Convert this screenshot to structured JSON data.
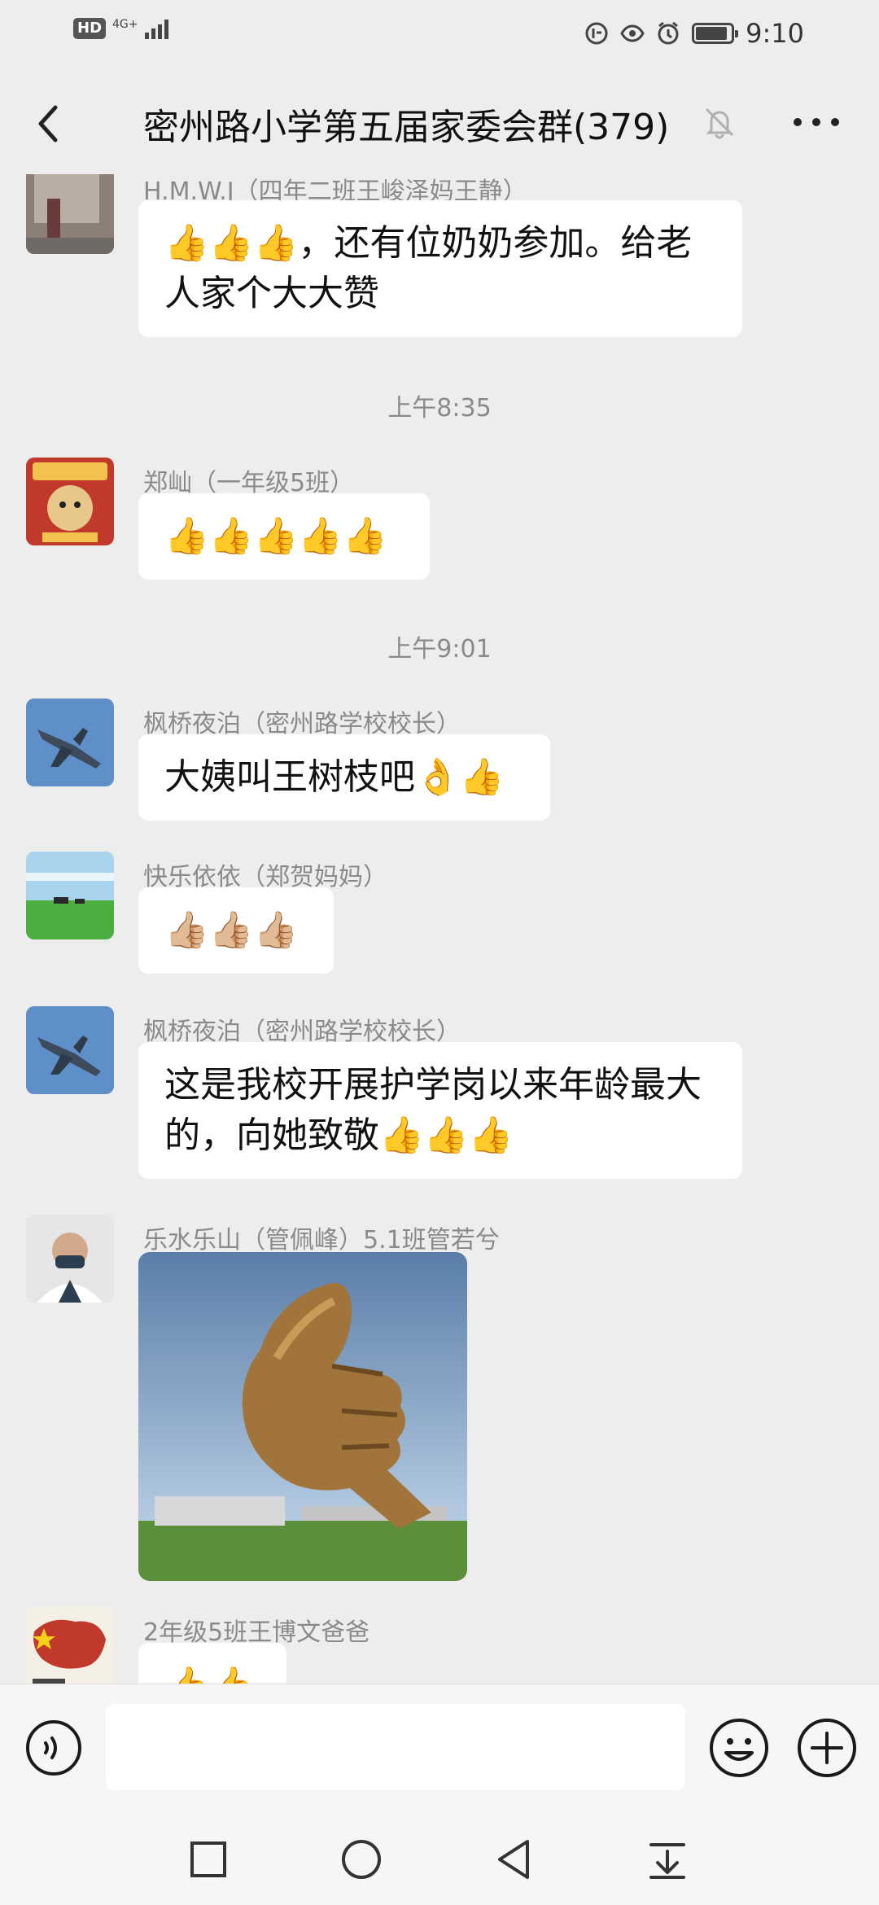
{
  "status_bar": {
    "hd": "HD",
    "network": "4G+",
    "time": "9:10",
    "battery_level": 0.9
  },
  "title_bar": {
    "title": "密州路小学第五届家委会群(379)"
  },
  "messages": [
    {
      "sender": "H.M.W.J（四年二班王峻泽妈王静）",
      "text": "👍👍👍，还有位奶奶参加。给老人家个大大赞"
    },
    {
      "timestamp": "上午8:35"
    },
    {
      "sender": "郑屾（一年级5班）",
      "text": "👍👍👍👍👍"
    },
    {
      "timestamp": "上午9:01"
    },
    {
      "sender": "枫桥夜泊（密州路学校校长）",
      "text": "大姨叫王树枝吧👌👍"
    },
    {
      "sender": "快乐依依（郑贺妈妈）",
      "text": "👍🏼👍🏼👍🏼"
    },
    {
      "sender": "枫桥夜泊（密州路学校校长）",
      "text": "这是我校开展护学岗以来年龄最大的，向她致敬👍👍👍"
    },
    {
      "sender": "乐水乐山（管佩峰）5.1班管若兮",
      "image": "thumbs-up-statue"
    },
    {
      "sender": "2年级5班王博文爸爸",
      "text": "👍👍"
    }
  ],
  "input": {
    "value": "",
    "placeholder": ""
  },
  "colors": {
    "background": "#ededed",
    "bubble": "#ffffff",
    "meta_text": "#8a8a8a"
  }
}
